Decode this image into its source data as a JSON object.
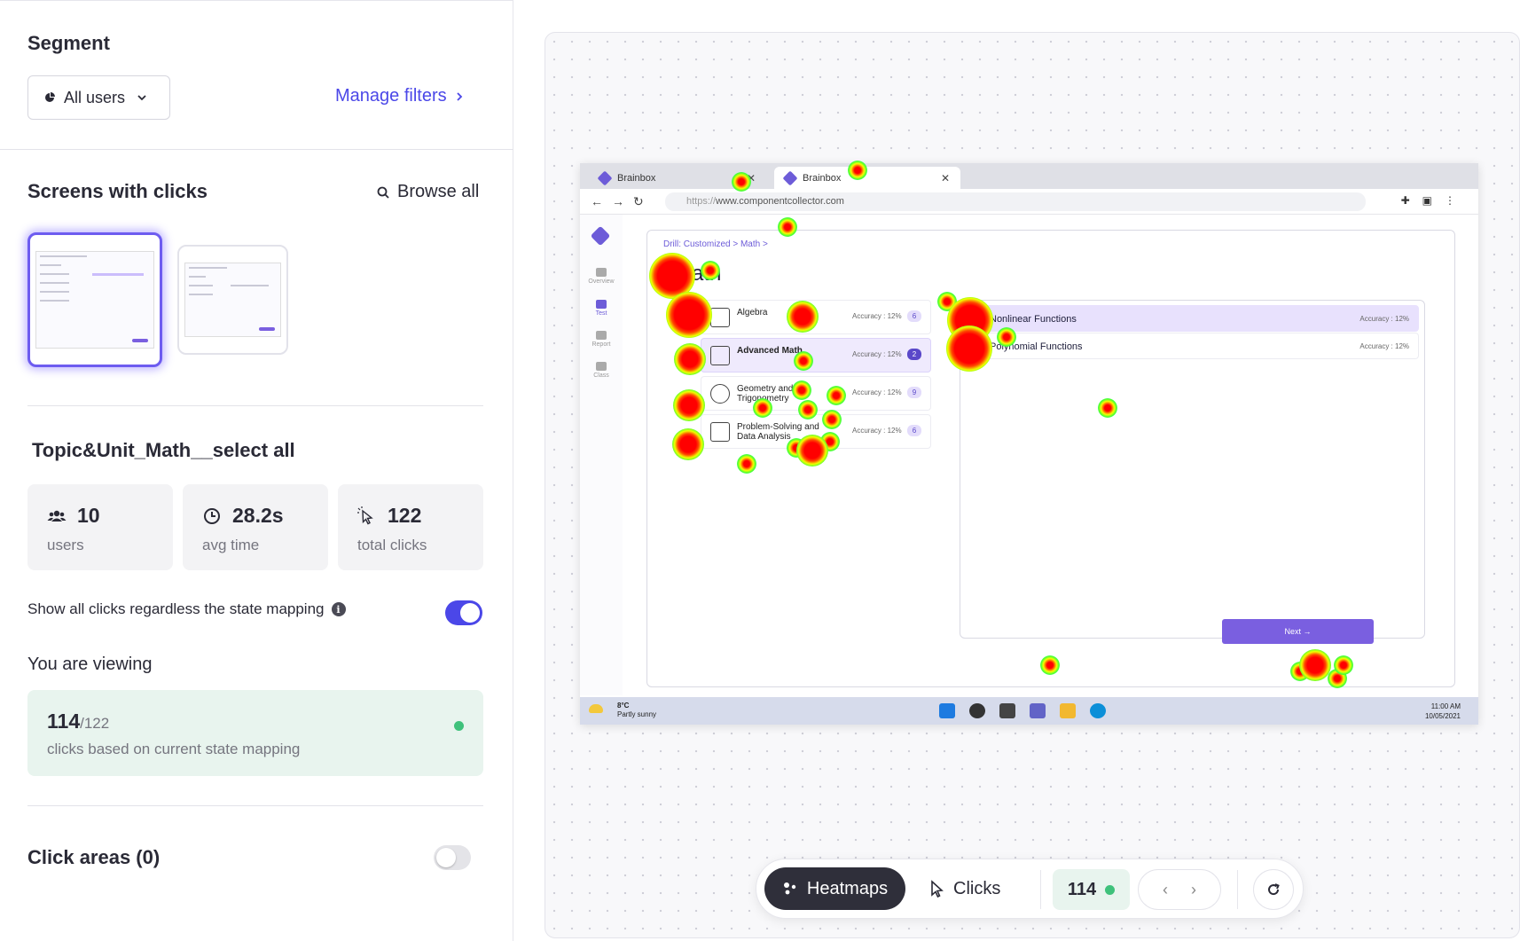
{
  "segment": {
    "title": "Segment",
    "dropdown_value": "All users",
    "manage_filters": "Manage filters"
  },
  "screens": {
    "title": "Screens with clicks",
    "browse_all": "Browse all"
  },
  "screen_name": "Topic&Unit_Math__select all",
  "stats": {
    "users": {
      "value": "10",
      "label": "users"
    },
    "avg_time": {
      "value": "28.2s",
      "label": "avg time"
    },
    "total_clicks": {
      "value": "122",
      "label": "total clicks"
    }
  },
  "show_all_clicks": {
    "label": "Show all clicks regardless the state mapping",
    "enabled": true
  },
  "viewing": {
    "title": "You are viewing",
    "count": "114",
    "total": "/122",
    "label": "clicks based on current state mapping"
  },
  "click_areas": {
    "label": "Click areas (0)",
    "enabled": false
  },
  "screenshot": {
    "tabs": [
      "Brainbox",
      "Brainbox"
    ],
    "url_proto": "https://",
    "url_host": "www.componentcollector.com",
    "sidebar": [
      "Overview",
      "Test",
      "Report",
      "Class"
    ],
    "breadcrumb": "Drill: Customized  >   Math  >",
    "title": "Math",
    "units": [
      {
        "name": "Algebra",
        "accuracy": "Accuracy : 12%",
        "count": "6"
      },
      {
        "name": "Advanced Math",
        "accuracy": "Accuracy : 12%",
        "count": "2"
      },
      {
        "name": "Geometry and Trigonometry",
        "accuracy": "Accuracy : 12%",
        "count": "9"
      },
      {
        "name": "Problem-Solving and Data Analysis",
        "accuracy": "Accuracy : 12%",
        "count": "6"
      }
    ],
    "topics": [
      {
        "name": "Nonlinear Functions",
        "accuracy": "Accuracy : 12%"
      },
      {
        "name": "Polynomial Functions",
        "accuracy": "Accuracy : 12%"
      }
    ],
    "next_button": "Next →",
    "weather_temp": "8°C",
    "weather_desc": "Partly sunny",
    "clock_time": "11:00 AM",
    "clock_date": "10/05/2021"
  },
  "toolbar": {
    "heatmaps": "Heatmaps",
    "clicks": "Clicks",
    "count": "114"
  },
  "colors": {
    "accent": "#4b47e8",
    "app_purple": "#6d5cd8",
    "success": "#3fc17b"
  }
}
